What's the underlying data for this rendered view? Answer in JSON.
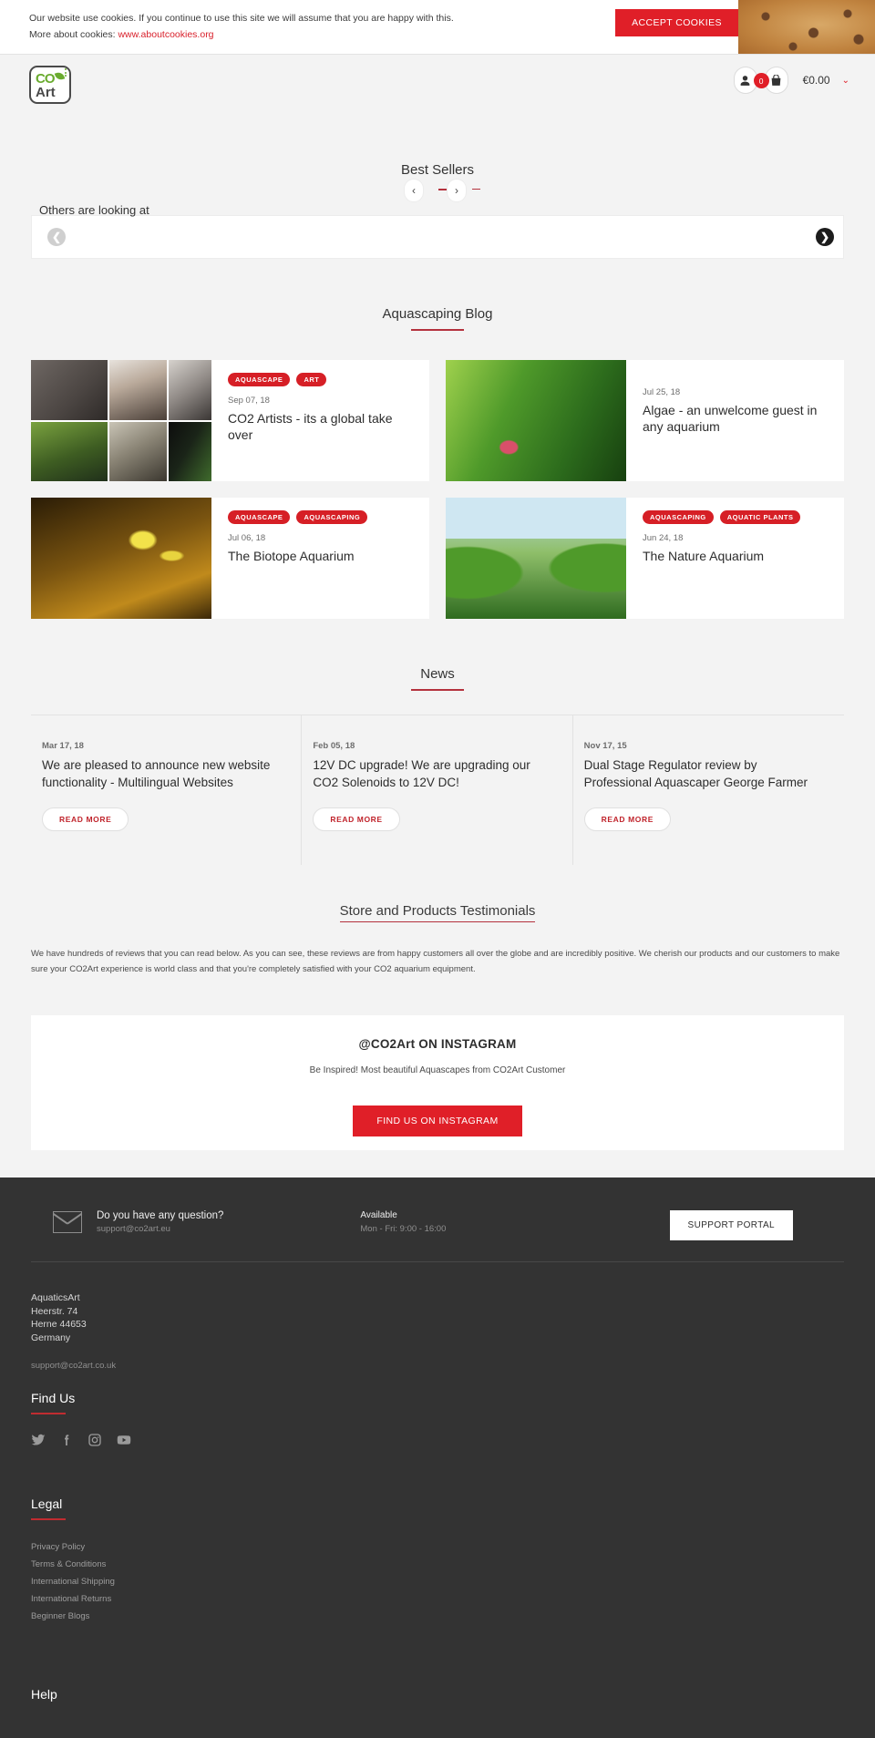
{
  "cookie": {
    "line1": "Our website use cookies. If you continue to use this site we will assume that you are happy with this.",
    "line2_prefix": "More about cookies: ",
    "link": "www.aboutcookies.org",
    "accept_label": "ACCEPT COOKIES"
  },
  "header": {
    "logo_top": "CO",
    "logo_sub": "Art",
    "cart_count": "0",
    "cart_total": "€0.00",
    "caret": "⌄"
  },
  "bestsellers": {
    "title": "Best Sellers",
    "prev": "‹",
    "next": "›"
  },
  "others": {
    "label": "Others are looking at",
    "prev": "❮",
    "next": "❯"
  },
  "blog": {
    "title": "Aquascaping Blog",
    "posts": [
      {
        "tags": [
          "AQUASCAPE",
          "ART"
        ],
        "date": "Sep 07, 18",
        "title": "CO2 Artists - its a global take over",
        "thumb": "collage-co2-artists"
      },
      {
        "tags": [],
        "date": "Jul 25, 18",
        "title": "Algae - an unwelcome guest in any aquarium",
        "thumb": "algae-plants-photo"
      },
      {
        "tags": [
          "AQUASCAPE",
          "AQUASCAPING"
        ],
        "date": "Jul 06, 18",
        "title": "The Biotope Aquarium",
        "thumb": "biotope-aquarium-photo"
      },
      {
        "tags": [
          "AQUASCAPING",
          "AQUATIC PLANTS"
        ],
        "date": "Jun 24, 18",
        "title": "The Nature Aquarium",
        "thumb": "nature-aquarium-photo"
      }
    ]
  },
  "news": {
    "title": "News",
    "read_more_label": "READ MORE",
    "items": [
      {
        "date": "Mar 17, 18",
        "title": "We are pleased to announce new website functionality - Multilingual Websites"
      },
      {
        "date": "Feb 05, 18",
        "title": "12V DC upgrade! We are upgrading our CO2 Solenoids to 12V DC!"
      },
      {
        "date": "Nov 17, 15",
        "title": "Dual Stage Regulator review by Professional Aquascaper George Farmer"
      }
    ]
  },
  "testimonials": {
    "title": "Store and Products Testimonials",
    "body": "We have hundreds of reviews that you can read below. As you can see, these reviews are from happy customers all over the globe and are incredibly positive. We cherish our products and our customers to make sure your CO2Art experience is world class and that you're completely satisfied with your CO2 aquarium equipment."
  },
  "instagram": {
    "title": "@CO2Art ON INSTAGRAM",
    "subtitle": "Be Inspired! Most beautiful Aquascapes from CO2Art Customer",
    "button": "FIND US ON INSTAGRAM"
  },
  "footer": {
    "support_question": "Do you have any question?",
    "support_email": "support@co2art.eu",
    "available_title": "Available",
    "available_hours": "Mon - Fri: 9:00 - 16:00",
    "support_portal": "SUPPORT PORTAL",
    "address": [
      "AquaticsArt",
      "Heerstr. 74",
      "Herne 44653",
      "Germany"
    ],
    "contact_email": "support@co2art.co.uk",
    "find_us_title": "Find Us",
    "legal_title": "Legal",
    "legal_links": [
      "Privacy Policy",
      "Terms & Conditions",
      "International Shipping",
      "International Returns",
      "Beginner Blogs"
    ],
    "help_title": "Help"
  },
  "colors": {
    "brand_red": "#e01f28",
    "tag_red": "#d61f26",
    "accent_rule": "#b4313d",
    "footer_bg": "#333333",
    "page_bg": "#f3f3f3"
  }
}
